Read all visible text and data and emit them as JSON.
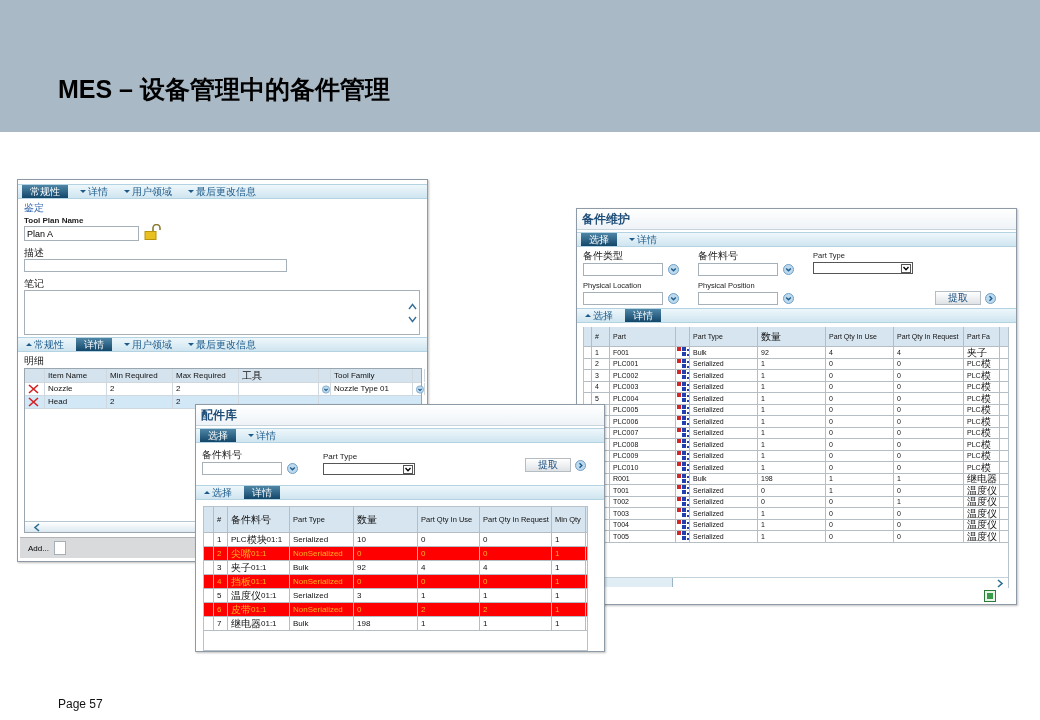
{
  "slide": {
    "title": "MES – 设备管理中的备件管理",
    "footer": "Page 57"
  },
  "tool_plan": {
    "tabs_top": [
      {
        "label": "常规性",
        "selected": true,
        "collapsed": false
      },
      {
        "label": "详情",
        "selected": false,
        "collapsed": false
      },
      {
        "label": "用户领域",
        "selected": false,
        "collapsed": false
      },
      {
        "label": "最后更改信息",
        "selected": false,
        "collapsed": false
      }
    ],
    "section_label": "鉴定",
    "name_label": "Tool Plan Name",
    "name_value": "Plan A",
    "locked": false,
    "description_label": "描述",
    "notes_label": "笔记",
    "tabs_bottom": [
      {
        "label": "常规性",
        "selected": false,
        "collapsed": true
      },
      {
        "label": "详情",
        "selected": true,
        "collapsed": false
      },
      {
        "label": "用户领域",
        "selected": false,
        "collapsed": false
      },
      {
        "label": "最后更改信息",
        "selected": false,
        "collapsed": false
      }
    ],
    "details_label": "明细",
    "table": {
      "columns": [
        "Item Name",
        "Min Required",
        "Max Required",
        "工具",
        "Tool Family"
      ],
      "rows": [
        {
          "item_name": "Nozzle",
          "min_required": "2",
          "max_required": "2",
          "tool_family": "Nozzle Type 01",
          "selected": false
        },
        {
          "item_name": "Head",
          "min_required": "2",
          "max_required": "2",
          "selected": true
        }
      ]
    },
    "add_button": "Add..."
  },
  "spare_maintenance": {
    "title": "备件维护",
    "tabs_top": [
      {
        "label": "选择",
        "selected": true,
        "collapsed": false
      },
      {
        "label": "详情",
        "selected": false,
        "collapsed": false
      }
    ],
    "fields": [
      {
        "label": "备件类型",
        "kind": "lookup"
      },
      {
        "label": "备件料号",
        "kind": "lookup"
      },
      {
        "label": "Part Type",
        "kind": "select"
      },
      {
        "label": "Physical Location",
        "kind": "lookup"
      },
      {
        "label": "Physical Position",
        "kind": "lookup"
      }
    ],
    "fetch_button": "提取",
    "tabs_bottom": [
      {
        "label": "选择",
        "selected": false,
        "collapsed": true
      },
      {
        "label": "详情",
        "selected": true,
        "collapsed": false
      }
    ],
    "table": {
      "columns": [
        "#",
        "Part",
        "Part Type",
        "数量",
        "Part Qty In Use",
        "Part Qty In Request",
        "Part Fa"
      ],
      "rows": [
        {
          "number": "1",
          "part": "F001",
          "part_type": "Bulk",
          "qty": "92",
          "in_use": "4",
          "in_request": "4",
          "family": "夹子"
        },
        {
          "number": "2",
          "part": "PLC001",
          "part_type": "Serialized",
          "qty": "1",
          "in_use": "0",
          "in_request": "0",
          "family": "PLC模"
        },
        {
          "number": "3",
          "part": "PLC002",
          "part_type": "Serialized",
          "qty": "1",
          "in_use": "0",
          "in_request": "0",
          "family": "PLC模"
        },
        {
          "number": "4",
          "part": "PLC003",
          "part_type": "Serialized",
          "qty": "1",
          "in_use": "0",
          "in_request": "0",
          "family": "PLC模"
        },
        {
          "number": "5",
          "part": "PLC004",
          "part_type": "Serialized",
          "qty": "1",
          "in_use": "0",
          "in_request": "0",
          "family": "PLC模"
        },
        {
          "part": "PLC005",
          "part_type": "Serialized",
          "qty": "1",
          "in_use": "0",
          "in_request": "0",
          "family": "PLC模"
        },
        {
          "part": "PLC006",
          "part_type": "Serialized",
          "qty": "1",
          "in_use": "0",
          "in_request": "0",
          "family": "PLC模"
        },
        {
          "part": "PLC007",
          "part_type": "Serialized",
          "qty": "1",
          "in_use": "0",
          "in_request": "0",
          "family": "PLC模"
        },
        {
          "part": "PLC008",
          "part_type": "Serialized",
          "qty": "1",
          "in_use": "0",
          "in_request": "0",
          "family": "PLC模"
        },
        {
          "part": "PLC009",
          "part_type": "Serialized",
          "qty": "1",
          "in_use": "0",
          "in_request": "0",
          "family": "PLC模"
        },
        {
          "part": "PLC010",
          "part_type": "Serialized",
          "qty": "1",
          "in_use": "0",
          "in_request": "0",
          "family": "PLC模"
        },
        {
          "part": "R001",
          "part_type": "Bulk",
          "qty": "198",
          "in_use": "1",
          "in_request": "1",
          "family": "继电器"
        },
        {
          "part": "T001",
          "part_type": "Serialized",
          "qty": "0",
          "in_use": "1",
          "in_request": "0",
          "family": "温度仪"
        },
        {
          "part": "T002",
          "part_type": "Serialized",
          "qty": "0",
          "in_use": "0",
          "in_request": "1",
          "family": "温度仪"
        },
        {
          "part": "T003",
          "part_type": "Serialized",
          "qty": "1",
          "in_use": "0",
          "in_request": "0",
          "family": "温度仪"
        },
        {
          "part": "T004",
          "part_type": "Serialized",
          "qty": "1",
          "in_use": "0",
          "in_request": "0",
          "family": "温度仪"
        },
        {
          "part": "T005",
          "part_type": "Serialized",
          "qty": "1",
          "in_use": "0",
          "in_request": "0",
          "family": "温度仪"
        }
      ]
    }
  },
  "parts_library": {
    "title": "配件库",
    "tabs_top": [
      {
        "label": "选择",
        "selected": true,
        "collapsed": false
      },
      {
        "label": "详情",
        "selected": false,
        "collapsed": false
      }
    ],
    "fields": [
      {
        "label": "备件料号",
        "kind": "lookup"
      },
      {
        "label": "Part Type",
        "kind": "select"
      }
    ],
    "fetch_button": "提取",
    "tabs_bottom": [
      {
        "label": "选择",
        "selected": false,
        "collapsed": true
      },
      {
        "label": "详情",
        "selected": true,
        "collapsed": false
      }
    ],
    "table": {
      "columns": [
        "#",
        "备件料号",
        "Part Type",
        "数量",
        "Part Qty In Use",
        "Part Qty In Request",
        "Min Qty"
      ],
      "rows": [
        {
          "number": "1",
          "part_no": "PLC模块01:1",
          "part_type": "Serialized",
          "qty": "10",
          "in_use": "0",
          "in_request": "0",
          "min_qty": "1",
          "alert": false
        },
        {
          "number": "2",
          "part_no": "尖嘴01:1",
          "part_type": "NonSerialized",
          "qty": "0",
          "in_use": "0",
          "in_request": "0",
          "min_qty": "1",
          "alert": true
        },
        {
          "number": "3",
          "part_no": "夹子01:1",
          "part_type": "Bulk",
          "qty": "92",
          "in_use": "4",
          "in_request": "4",
          "min_qty": "1",
          "alert": false
        },
        {
          "number": "4",
          "part_no": "挡板01:1",
          "part_type": "NonSerialized",
          "qty": "0",
          "in_use": "0",
          "in_request": "0",
          "min_qty": "1",
          "alert": true
        },
        {
          "number": "5",
          "part_no": "温度仪01:1",
          "part_type": "Serialized",
          "qty": "3",
          "in_use": "1",
          "in_request": "1",
          "min_qty": "1",
          "alert": false
        },
        {
          "number": "6",
          "part_no": "皮带01:1",
          "part_type": "NonSerialized",
          "qty": "0",
          "in_use": "2",
          "in_request": "2",
          "min_qty": "1",
          "alert": true
        },
        {
          "number": "7",
          "part_no": "继电器01:1",
          "part_type": "Bulk",
          "qty": "198",
          "in_use": "1",
          "in_request": "1",
          "min_qty": "1",
          "alert": false
        }
      ]
    }
  }
}
